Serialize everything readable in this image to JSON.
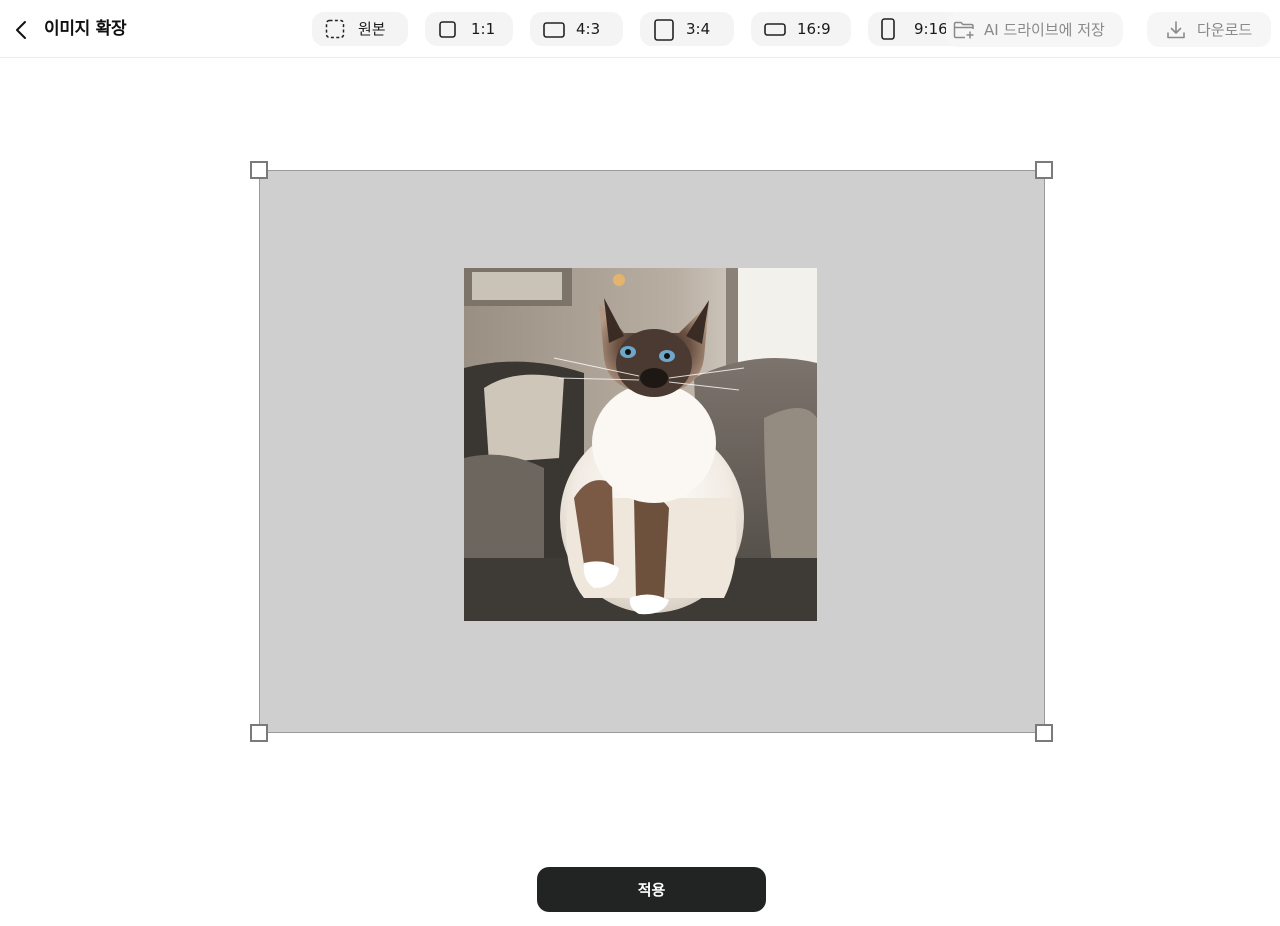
{
  "header": {
    "title": "이미지 확장",
    "ratios": [
      {
        "label": "원본",
        "icon": "dashed-square-icon"
      },
      {
        "label": "1:1",
        "icon": "square-icon"
      },
      {
        "label": "4:3",
        "icon": "landscape-rect-icon"
      },
      {
        "label": "3:4",
        "icon": "portrait-rect-icon"
      },
      {
        "label": "16:9",
        "icon": "wide-rect-icon"
      },
      {
        "label": "9:16",
        "icon": "tall-rect-icon"
      }
    ],
    "save_label": "AI 드라이브에 저장",
    "download_label": "다운로드"
  },
  "canvas": {
    "background_color": "#cfcfcf",
    "image_subject": "siamese-cat-on-sofa"
  },
  "footer": {
    "apply_label": "적용"
  }
}
